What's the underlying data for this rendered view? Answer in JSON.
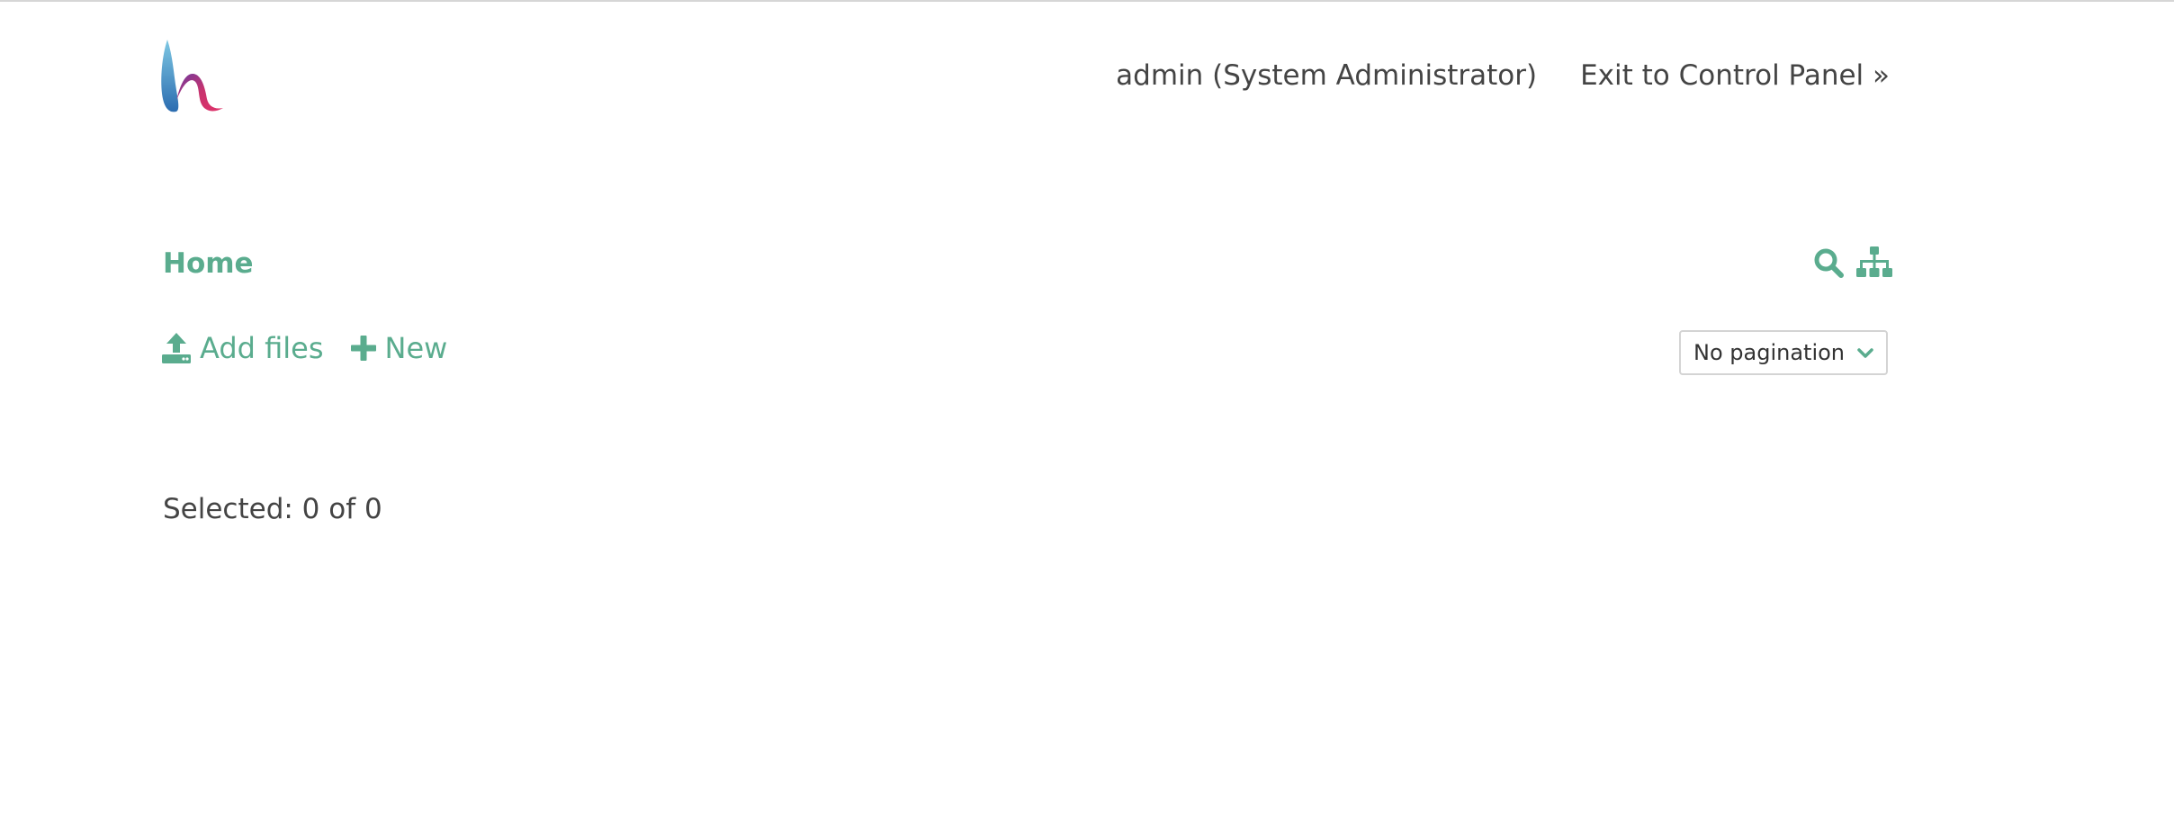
{
  "header": {
    "user_label": "admin (System Administrator)",
    "exit_label": "Exit to Control Panel »"
  },
  "breadcrumb": {
    "home_label": "Home"
  },
  "toolbar": {
    "add_files_label": "Add files",
    "new_label": "New",
    "pagination": {
      "selected": "No pagination"
    }
  },
  "selection": {
    "summary": "Selected: 0 of 0"
  },
  "colors": {
    "accent": "#5aac8e",
    "text": "#444444",
    "border": "#d4d4d4"
  },
  "icons": {
    "search": "search-icon",
    "tree": "sitemap-icon",
    "upload": "upload-icon",
    "plus": "plus-icon",
    "chevron": "chevron-down-icon"
  }
}
